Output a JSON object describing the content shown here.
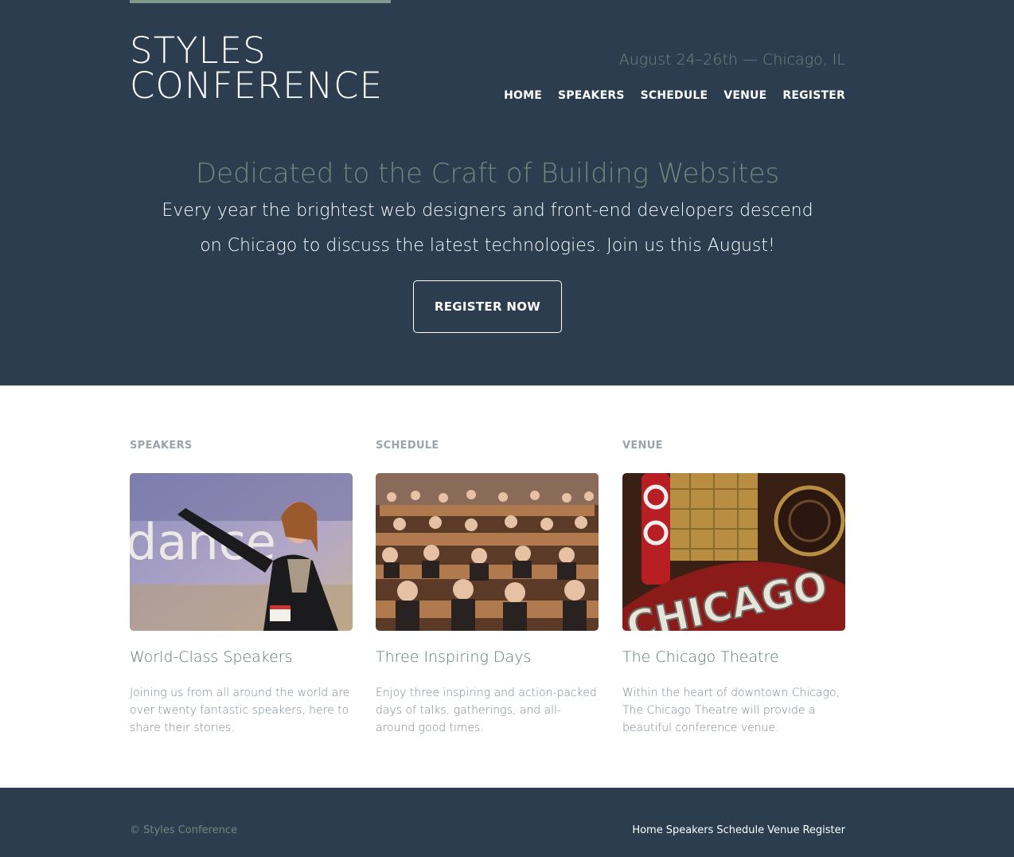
{
  "header": {
    "logo_line1": "STYLES",
    "logo_line2": "CONFERENCE",
    "tagline": "August 24–26th — Chicago, IL",
    "nav": [
      "HOME",
      "SPEAKERS",
      "SCHEDULE",
      "VENUE",
      "REGISTER"
    ]
  },
  "hero": {
    "title": "Dedicated to the Craft of Building Websites",
    "text": "Every year the brightest web designers and front-end developers descend on Chicago to discuss the latest technologies. Join us this August!",
    "button": "REGISTER NOW"
  },
  "cards": [
    {
      "label": "SPEAKERS",
      "title": "World-Class Speakers",
      "description": "Joining us from all around the world are over twenty fantastic speakers, here to share their stories.",
      "image_words": "dance"
    },
    {
      "label": "SCHEDULE",
      "title": "Three Inspiring Days",
      "description": "Enjoy three inspiring and action-packed days of talks, gatherings, and all-around good times."
    },
    {
      "label": "VENUE",
      "title": "The Chicago Theatre",
      "description": "Within the heart of downtown Chicago, The Chicago Theatre will provide a beautiful conference venue.",
      "image_words": "CHICAGO"
    }
  ],
  "footer": {
    "copyright": "© Styles Conference",
    "nav": [
      "Home",
      "Speakers",
      "Schedule",
      "Venue",
      "Register"
    ]
  },
  "colors": {
    "navy": "#2b3d4f",
    "sage": "#6e8a7c",
    "white": "#ffffff"
  }
}
